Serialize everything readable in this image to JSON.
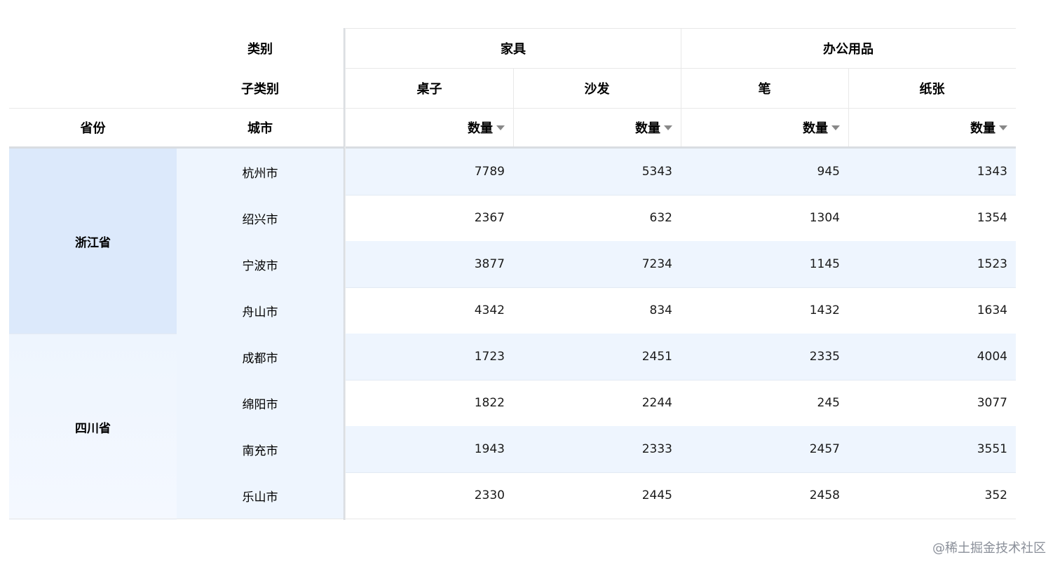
{
  "header": {
    "corner_category": "类别",
    "corner_subcategory": "子类别",
    "row_field_province": "省份",
    "row_field_city": "城市",
    "categories": [
      {
        "label": "家具",
        "subcategories": [
          "桌子",
          "沙发"
        ]
      },
      {
        "label": "办公用品",
        "subcategories": [
          "笔",
          "纸张"
        ]
      }
    ],
    "measure_label": "数量"
  },
  "rows": [
    {
      "province": "浙江省",
      "city": "杭州市",
      "values": [
        "7789",
        "5343",
        "945",
        "1343"
      ]
    },
    {
      "province": "浙江省",
      "city": "绍兴市",
      "values": [
        "2367",
        "632",
        "1304",
        "1354"
      ]
    },
    {
      "province": "浙江省",
      "city": "宁波市",
      "values": [
        "3877",
        "7234",
        "1145",
        "1523"
      ]
    },
    {
      "province": "浙江省",
      "city": "舟山市",
      "values": [
        "4342",
        "834",
        "1432",
        "1634"
      ]
    },
    {
      "province": "四川省",
      "city": "成都市",
      "values": [
        "1723",
        "2451",
        "2335",
        "4004"
      ]
    },
    {
      "province": "四川省",
      "city": "绵阳市",
      "values": [
        "1822",
        "2244",
        "245",
        "3077"
      ]
    },
    {
      "province": "四川省",
      "city": "南充市",
      "values": [
        "1943",
        "2333",
        "2457",
        "3551"
      ]
    },
    {
      "province": "四川省",
      "city": "乐山市",
      "values": [
        "2330",
        "2445",
        "2458",
        "352"
      ]
    }
  ],
  "province_groups": [
    {
      "label": "浙江省",
      "color": "#dce9fb"
    },
    {
      "label": "四川省",
      "color": "#eef5fe"
    }
  ],
  "colors": {
    "stripe": "#eef5fe",
    "province_highlight": "#dce9fb",
    "border": "#e8e8e8"
  },
  "watermark": "@稀土掘金技术社区"
}
